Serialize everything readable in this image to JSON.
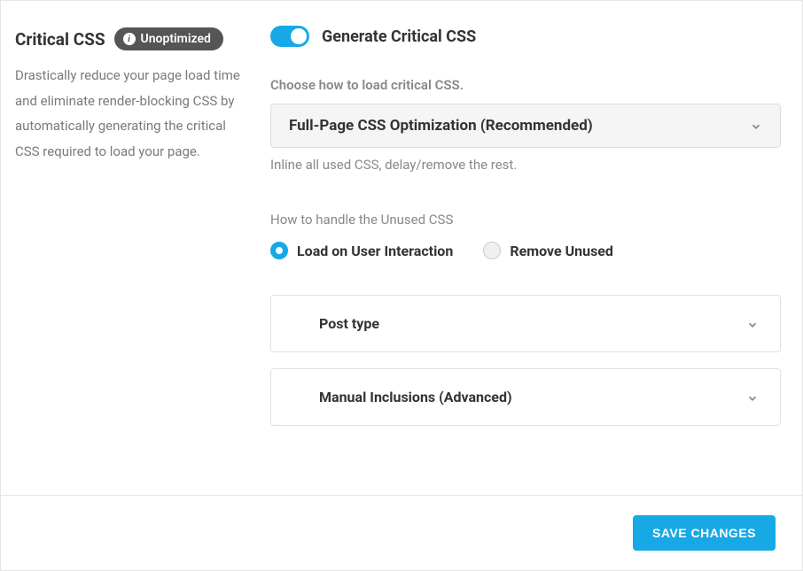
{
  "left": {
    "title": "Critical CSS",
    "badge": "Unoptimized",
    "description": "Drastically reduce your page load time and eliminate render-blocking CSS by automatically generating the critical CSS required to load your page."
  },
  "toggle": {
    "enabled": true,
    "label": "Generate Critical CSS"
  },
  "loadMode": {
    "label": "Choose how to load critical CSS.",
    "selected": "Full-Page CSS Optimization (Recommended)",
    "hint": "Inline all used CSS, delay/remove the rest."
  },
  "unusedCss": {
    "label": "How to handle the Unused CSS",
    "options": [
      {
        "label": "Load on User Interaction",
        "selected": true
      },
      {
        "label": "Remove Unused",
        "selected": false
      }
    ]
  },
  "accordion1": {
    "title": "Post type"
  },
  "accordion2": {
    "title": "Manual Inclusions (Advanced)"
  },
  "footer": {
    "save": "SAVE CHANGES"
  }
}
